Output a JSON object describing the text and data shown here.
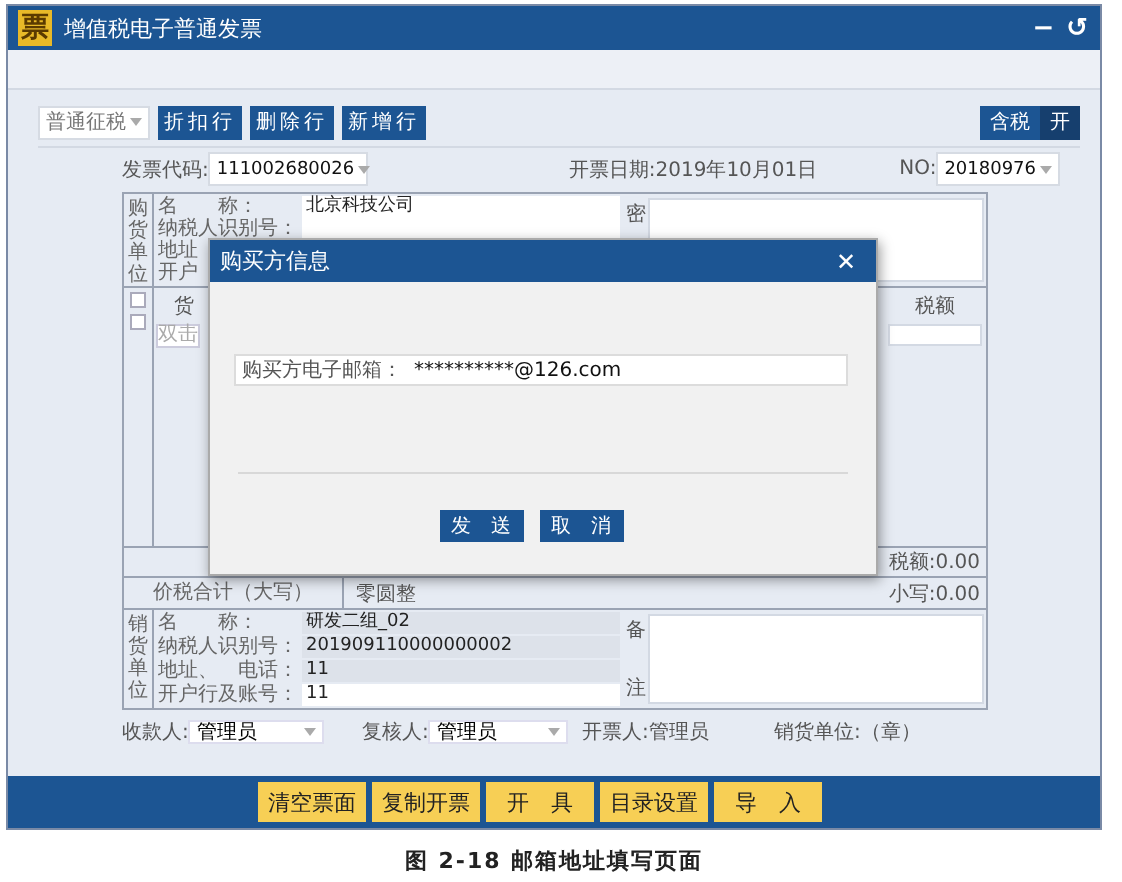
{
  "window": {
    "logo": "票",
    "title": "增值税电子普通发票",
    "controls": [
      "−",
      "↺"
    ]
  },
  "toolbar": {
    "tax_type": "普通征税",
    "buttons": [
      "折扣行",
      "删除行",
      "新增行"
    ],
    "tax_toggle": {
      "label": "含税",
      "state": "开"
    }
  },
  "header": {
    "code_label": "发票代码:",
    "code": "111002680026",
    "date_label": "开票日期:",
    "date": "2019年10月01日",
    "no_label": "NO:",
    "no": "20180976"
  },
  "buyer": {
    "side_label": "购货单位",
    "fields": [
      {
        "label": "名　　称：",
        "value": "北京科技公司"
      },
      {
        "label": "纳税人识别号："
      },
      {
        "label": "地址"
      },
      {
        "label": "开户"
      }
    ],
    "note_label": "密"
  },
  "goods": {
    "checkboxes": [
      {
        "checked": false
      },
      {
        "checked": false
      }
    ],
    "column_1": "货",
    "tax_header": "税额",
    "placeholder": "双击"
  },
  "tax_total": "税额:0.00",
  "total": {
    "label": "价税合计（大写）",
    "words": "零圆整",
    "small": "小写:0.00"
  },
  "seller": {
    "side_label": "销货单位",
    "fields": [
      {
        "label": "名　　称：",
        "value": "研发二组_02",
        "editable": false
      },
      {
        "label": "纳税人识别号：",
        "value": "201909110000000002",
        "editable": false
      },
      {
        "label": "地址、　电话：",
        "value": "11",
        "editable": false
      },
      {
        "label": "开户行及账号：",
        "value": "11",
        "editable": true
      }
    ],
    "note_labels": [
      "备",
      "注"
    ]
  },
  "signers": [
    {
      "kind": "select",
      "label": "收款人:",
      "value": "管理员"
    },
    {
      "kind": "select",
      "label": "复核人:",
      "value": "管理员"
    },
    {
      "kind": "text",
      "label": "开票人:",
      "value": "管理员"
    },
    {
      "kind": "text",
      "label": "销货单位:",
      "value": "（章）"
    }
  ],
  "footer_buttons": [
    "清空票面",
    "复制开票",
    "开　具",
    "目录设置",
    "导　入"
  ],
  "dialog": {
    "title": "购买方信息",
    "close": "✕",
    "email_label": "购买方电子邮箱：",
    "email": "**********@126.com",
    "buttons": [
      "发　送",
      "取　消"
    ]
  },
  "caption": "图 2-18 邮箱地址填写页面"
}
